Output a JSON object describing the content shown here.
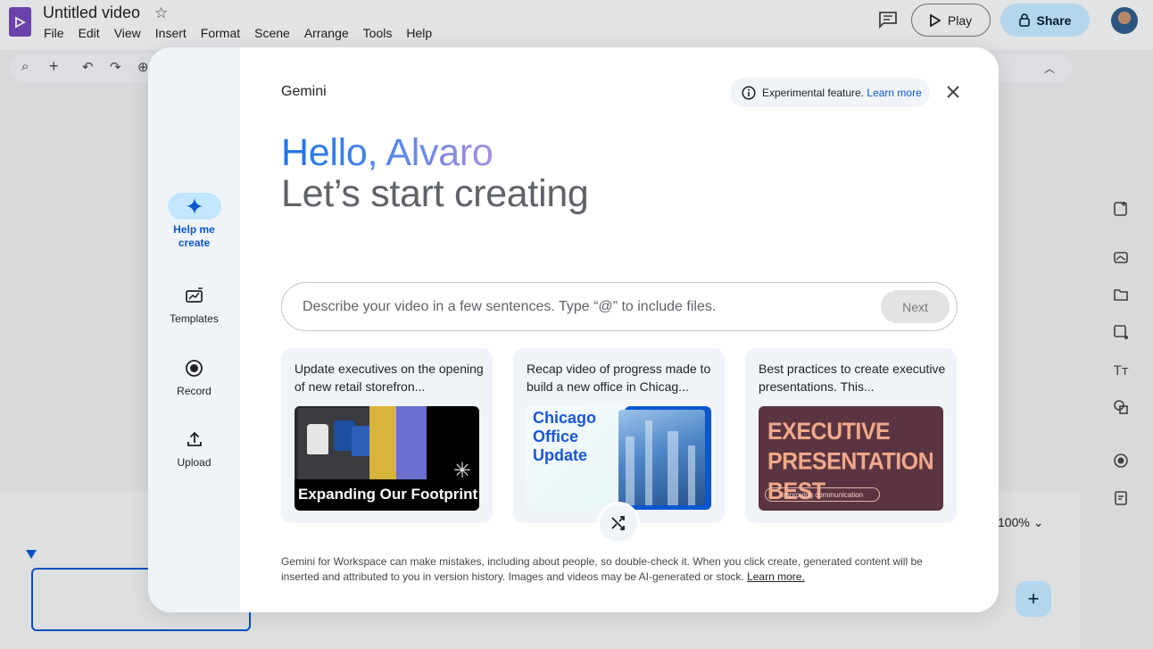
{
  "app": {
    "doc_title": "Untitled video",
    "menu": [
      "File",
      "Edit",
      "View",
      "Insert",
      "Format",
      "Scene",
      "Arrange",
      "Tools",
      "Help"
    ],
    "play_label": "Play",
    "share_label": "Share",
    "zoom_level": "100%"
  },
  "dialog": {
    "title": "Gemini",
    "experimental_text": "Experimental feature.",
    "experimental_link": "Learn more",
    "greeting": "Hello, Alvaro",
    "subheading": "Let’s start creating",
    "rail": [
      {
        "label": "Help me create",
        "icon": "sparkle-icon",
        "active": true
      },
      {
        "label": "Templates",
        "icon": "templates-icon",
        "active": false
      },
      {
        "label": "Record",
        "icon": "record-icon",
        "active": false
      },
      {
        "label": "Upload",
        "icon": "upload-icon",
        "active": false
      }
    ],
    "prompt": {
      "placeholder": "Describe your video in a few sentences. Type “@” to include files.",
      "next_label": "Next"
    },
    "suggestions": [
      {
        "text": "Update executives on the opening of new retail storefron...",
        "thumb_caption": "Expanding Our Footprint"
      },
      {
        "text": "Recap video of progress made to build a new office in Chicag...",
        "thumb_caption": "Chicago Office Update"
      },
      {
        "text": "Best practices to create executive presentations. This...",
        "thumb_caption": "EXECUTIVE PRESENTATION BEST PRACTICES",
        "thumb_sub": "Improving communication"
      }
    ],
    "disclaimer": "Gemini for Workspace can make mistakes, including about people, so double-check it. When you click create, generated content will be inserted and attributed to you in version history. Images and videos may be AI-generated or stock.",
    "disclaimer_link": "Learn more."
  },
  "colors": {
    "accent_blue": "#0b57d0",
    "rail_bg": "#f0f4f9",
    "active_pill": "#c2e7ff"
  }
}
